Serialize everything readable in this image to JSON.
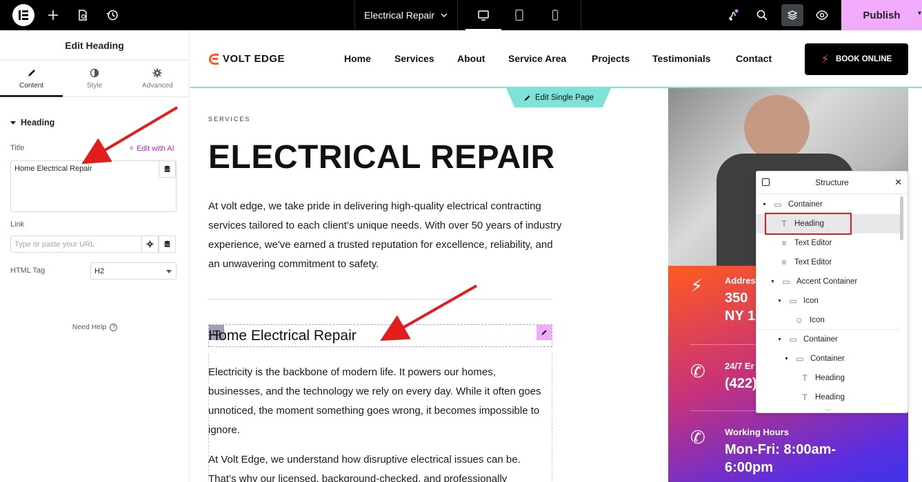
{
  "topbar": {
    "document_title": "Electrical Repair",
    "publish_label": "Publish"
  },
  "panel": {
    "title": "Edit Heading",
    "tabs": [
      {
        "label": "Content",
        "icon": "pencil-icon"
      },
      {
        "label": "Style",
        "icon": "half-circle-icon"
      },
      {
        "label": "Advanced",
        "icon": "gear-icon"
      }
    ],
    "section": "Heading",
    "title_label": "Title",
    "edit_with_ai": "Edit with AI",
    "title_value": "Home Electrical Repair",
    "link_label": "Link",
    "link_placeholder": "Type or paste your URL",
    "html_tag_label": "HTML Tag",
    "html_tag_value": "H2",
    "need_help": "Need Help"
  },
  "site": {
    "brand": "VOLT EDGE",
    "nav": [
      "Home",
      "Services",
      "About",
      "Service Area",
      "Projects",
      "Testimonials",
      "Contact"
    ],
    "book_button": "BOOK ONLINE",
    "edit_single_page": "Edit Single Page",
    "kicker": "SERVICES",
    "page_heading": "ELECTRICAL REPAIR",
    "intro": "At volt edge, we take pride in delivering high-quality electrical contracting services tailored to each client’s unique needs. With over 50 years of industry experience, we've earned a trusted reputation for excellence, reliability, and an unwavering commitment to safety.",
    "section_heading": "Home Electrical Repair",
    "para1": "Electricity is the backbone of modern life. It powers our homes, businesses, and the technology we rely on every day. While it often goes unnoticed, the moment something goes wrong, it becomes impossible to ignore.",
    "para2": "At Volt Edge, we understand how disruptive electrical issues can be. That’s why our licensed, background-checked, and professionally"
  },
  "promo": {
    "address_label": "Addres",
    "address_line1": "350",
    "address_line2": "NY 10",
    "emergency_label": "24/7 Er",
    "emergency_value": "(422)",
    "hours_label": "Working Hours",
    "hours_line1": "Mon-Fri: 8:00am-",
    "hours_line2": "6:00pm"
  },
  "structure": {
    "title": "Structure",
    "items": [
      {
        "label": "Container",
        "icon": "container-icon"
      },
      {
        "label": "Heading",
        "icon": "heading-icon",
        "selected": true
      },
      {
        "label": "Text Editor",
        "icon": "text-editor-icon"
      },
      {
        "label": "Text Editor",
        "icon": "text-editor-icon"
      },
      {
        "label": "Accent Container",
        "icon": "container-icon"
      },
      {
        "label": "Icon",
        "icon": "container-icon"
      },
      {
        "label": "Icon",
        "icon": "icon-widget-icon"
      },
      {
        "label": "Container",
        "icon": "container-icon"
      },
      {
        "label": "Container",
        "icon": "container-icon"
      },
      {
        "label": "Heading",
        "icon": "heading-icon"
      },
      {
        "label": "Heading",
        "icon": "heading-icon"
      }
    ],
    "more": "..."
  }
}
